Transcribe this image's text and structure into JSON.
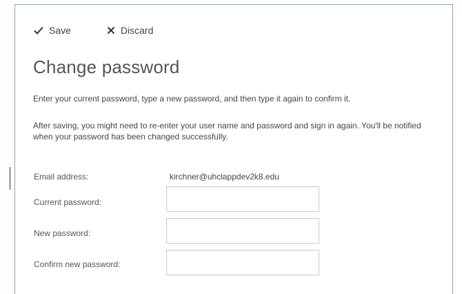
{
  "toolbar": {
    "save_label": "Save",
    "discard_label": "Discard"
  },
  "page": {
    "title": "Change password",
    "instructions": "Enter your current password, type a new password, and then type it again to confirm it.",
    "note": "After saving, you might need to re-enter your user name and password and sign in again. You'll be notified when your password has been changed successfully."
  },
  "form": {
    "email_label": "Email address:",
    "email_value": "kirchner@uhclappdev2k8.edu",
    "current_label": "Current password:",
    "current_value": "",
    "new_label": "New password:",
    "new_value": "",
    "confirm_label": "Confirm new password:",
    "confirm_value": ""
  },
  "icons": {
    "save": "checkmark-icon",
    "discard": "x-icon"
  },
  "colors": {
    "panel_border": "#8aa2b8",
    "text": "#444444",
    "input_border": "#c8c8c8"
  }
}
